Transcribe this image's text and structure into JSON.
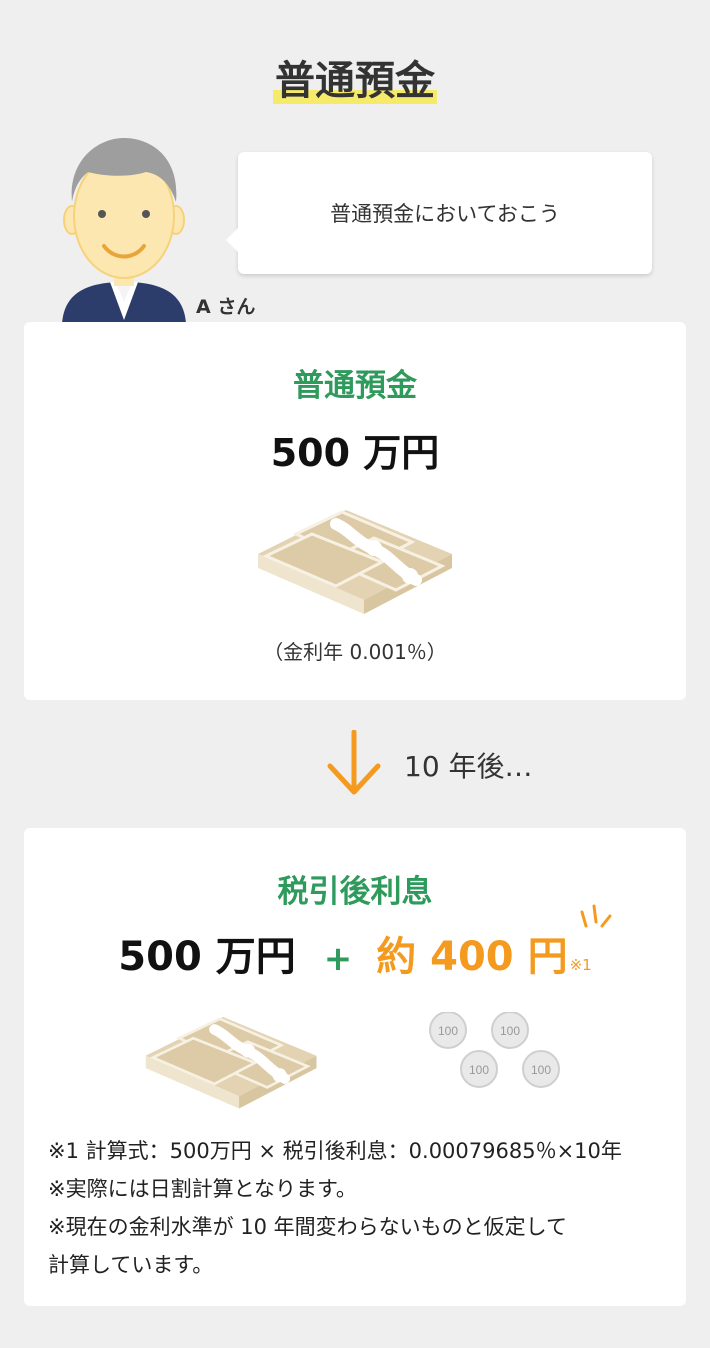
{
  "title": "普通預金",
  "bubble_text": "普通預金においておこう",
  "person_name": "A さん",
  "card1": {
    "title": "普通預金",
    "amount": "500 万円",
    "rate": "（金利年 0.001％）"
  },
  "arrow_label": "10 年後…",
  "card2": {
    "title": "税引後利息",
    "principal": "500 万円",
    "plus": "+",
    "interest": "約 400 円",
    "interest_note": "※1",
    "coin_label": "100",
    "notes": [
      "※1 計算式：500万円 × 税引後利息：0.00079685％×10年",
      "※実際には日割計算となります。",
      "※現在の金利水準が 10 年間変わらないものと仮定して",
      "計算しています。"
    ]
  },
  "colors": {
    "accent_green": "#2e9a5b",
    "accent_orange": "#f39a1f",
    "highlight_yellow": "#f6ea6a"
  }
}
